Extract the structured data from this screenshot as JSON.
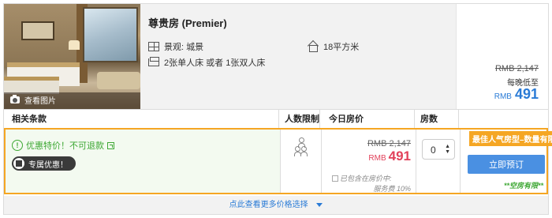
{
  "room": {
    "name": "尊贵房 (Premier)",
    "view_label": "景观: 城景",
    "area_label": "18平方米",
    "bed_label": "2张单人床 或者 1张双人床",
    "photo_link": "查看图片"
  },
  "summary_price": {
    "original": "RMB 2,147",
    "note": "每晚低至",
    "currency": "RMB",
    "price": "491"
  },
  "table": {
    "headers": {
      "terms": "相关条款",
      "people": "人数限制",
      "price": "今日房价",
      "rooms": "房数"
    }
  },
  "offer": {
    "promo_text": "优惠特价！不可退款",
    "special_badge": "专属优惠！",
    "original_price": "RMB 2,147",
    "currency": "RMB",
    "price": "491",
    "tax_line1": "已包含在房价中:",
    "tax_line2": "服务费 10%",
    "room_count": "0",
    "tag": "最佳人气房型–数量有限！",
    "book_label": "立即预订",
    "vacancy": "**空房有限**"
  },
  "more_link": "点此查看更多价格选择",
  "colors": {
    "accent_blue": "#2a7bd6",
    "button_blue": "#4a90e2",
    "price_red": "#e2415a",
    "promo_green": "#3ea834",
    "tag_orange": "#f5a623"
  }
}
